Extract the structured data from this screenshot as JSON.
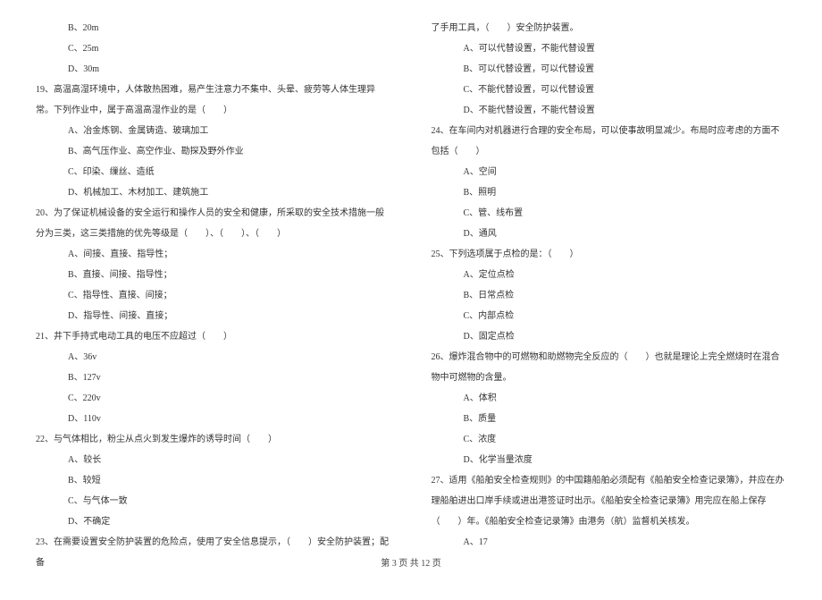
{
  "left": {
    "opt_b18": "B、20m",
    "opt_c18": "C、25m",
    "opt_d18": "D、30m",
    "q19": "19、高温高湿环境中，人体散热困难，易产生注意力不集中、头晕、疲劳等人体生理异常。下列作业中，属于高温高湿作业的是（　　）",
    "q19a": "A、冶金炼钢、金属铸造、玻璃加工",
    "q19b": "B、高气压作业、高空作业、勘探及野外作业",
    "q19c": "C、印染、缫丝、造纸",
    "q19d": "D、机械加工、木材加工、建筑施工",
    "q20": "20、为了保证机械设备的安全运行和操作人员的安全和健康，所采取的安全技术措施一般分为三类，这三类措施的优先等级是（　　）、（　　）、（　　）",
    "q20a": "A、间接、直接、指导性；",
    "q20b": "B、直接、间接、指导性；",
    "q20c": "C、指导性、直接、间接；",
    "q20d": "D、指导性、间接、直接；",
    "q21": "21、井下手持式电动工具的电压不应超过（　　）",
    "q21a": "A、36v",
    "q21b": "B、127v",
    "q21c": "C、220v",
    "q21d": "D、110v",
    "q22": "22、与气体相比，粉尘从点火到发生爆炸的诱导时间（　　）",
    "q22a": "A、较长",
    "q22b": "B、较短",
    "q22c": "C、与气体一致",
    "q22d": "D、不确定",
    "q23": "23、在需要设置安全防护装置的危险点，使用了安全信息提示，（　　）安全防护装置；配备"
  },
  "right": {
    "q23cont": "了手用工具，（　　）安全防护装置。",
    "q23a": "A、可以代替设置，不能代替设置",
    "q23b": "B、可以代替设置，可以代替设置",
    "q23c": "C、不能代替设置，可以代替设置",
    "q23d": "D、不能代替设置，不能代替设置",
    "q24": "24、在车间内对机器进行合理的安全布局，可以使事故明显减少。布局时应考虑的方面不包括（　　）",
    "q24a": "A、空间",
    "q24b": "B、照明",
    "q24c": "C、管、线布置",
    "q24d": "D、通风",
    "q25": "25、下列选项属于点检的是：（　　）",
    "q25a": "A、定位点检",
    "q25b": "B、日常点检",
    "q25c": "C、内部点检",
    "q25d": "D、固定点检",
    "q26": "26、爆炸混合物中的可燃物和助燃物完全反应的（　　）也就是理论上完全燃烧时在混合物中可燃物的含量。",
    "q26a": "A、体积",
    "q26b": "B、质量",
    "q26c": "C、浓度",
    "q26d": "D、化学当量浓度",
    "q27": "27、适用《船舶安全检查规则》的中国籍船舶必须配有《船舶安全检查记录簿》，并应在办理船舶进出口岸手续或进出港签证时出示。《船舶安全检查记录簿》用完应在船上保存（　　）年。《船舶安全检查记录簿》由港务（航）监督机关核发。",
    "q27a": "A、17"
  },
  "footer": "第 3 页 共 12 页"
}
